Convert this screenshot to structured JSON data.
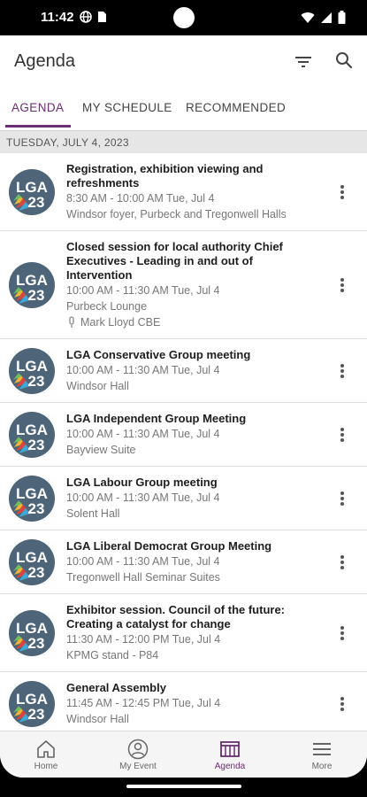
{
  "status_bar": {
    "time": "11:42"
  },
  "app_bar": {
    "title": "Agenda"
  },
  "tabs": [
    {
      "label": "AGENDA",
      "active": true
    },
    {
      "label": "MY SCHEDULE",
      "active": false
    },
    {
      "label": "RECOMMENDED",
      "active": false
    }
  ],
  "date_header": "TUESDAY, JULY 4, 2023",
  "logo": {
    "line1": "LGA",
    "line2": "23"
  },
  "sessions": [
    {
      "title_lines": [
        "Registration, exhibition viewing and",
        "refreshments"
      ],
      "time": "8:30 AM - 10:00 AM Tue, Jul 4",
      "location": "Windsor foyer, Purbeck and Tregonwell Halls",
      "speaker": ""
    },
    {
      "title_lines": [
        "Closed session for local authority Chief",
        "Executives - Leading in and out of",
        "Intervention"
      ],
      "time": "10:00 AM - 11:30 AM Tue, Jul 4",
      "location": "Purbeck Lounge",
      "speaker": "Mark Lloyd CBE"
    },
    {
      "title_lines": [
        "LGA Conservative Group meeting"
      ],
      "time": "10:00 AM - 11:30 AM Tue, Jul 4",
      "location": "Windsor Hall",
      "speaker": ""
    },
    {
      "title_lines": [
        "LGA Independent Group Meeting"
      ],
      "time": "10:00 AM - 11:30 AM Tue, Jul 4",
      "location": "Bayview Suite",
      "speaker": ""
    },
    {
      "title_lines": [
        "LGA Labour Group meeting"
      ],
      "time": "10:00 AM - 11:30 AM Tue, Jul 4",
      "location": "Solent Hall",
      "speaker": ""
    },
    {
      "title_lines": [
        "LGA Liberal Democrat Group Meeting"
      ],
      "time": "10:00 AM - 11:30 AM Tue, Jul 4",
      "location": "Tregonwell Hall Seminar Suites",
      "speaker": ""
    },
    {
      "title_lines": [
        "Exhibitor session. Council of the future:",
        "Creating a catalyst for change"
      ],
      "time": "11:30 AM - 12:00 PM Tue, Jul 4",
      "location": "KPMG stand - P84",
      "speaker": ""
    },
    {
      "title_lines": [
        "General Assembly"
      ],
      "time": "11:45 AM - 12:45 PM Tue, Jul 4",
      "location": "Windsor Hall",
      "speaker": ""
    }
  ],
  "bottom_nav": [
    {
      "label": "Home",
      "icon": "home-icon",
      "active": false
    },
    {
      "label": "My Event",
      "icon": "person-icon",
      "active": false
    },
    {
      "label": "Agenda",
      "icon": "calendar-icon",
      "active": true
    },
    {
      "label": "More",
      "icon": "menu-icon",
      "active": false
    }
  ],
  "colors": {
    "accent": "#6b2d73",
    "logo_bg": "#4e6478"
  }
}
